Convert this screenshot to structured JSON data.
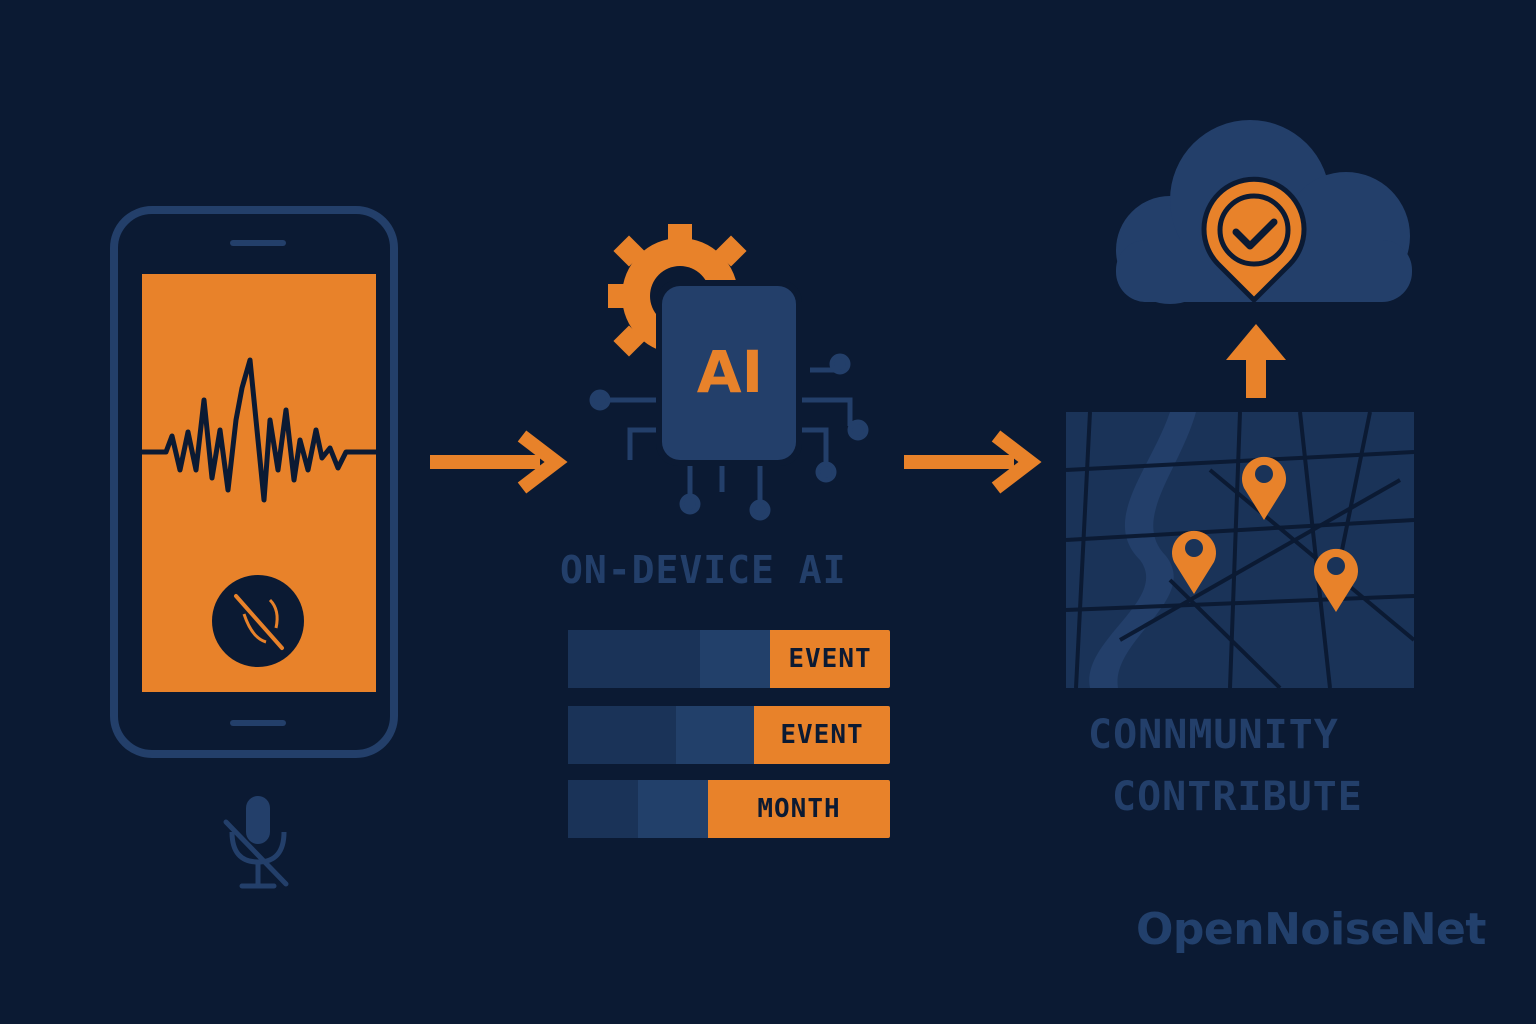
{
  "colors": {
    "background": "#0b1a33",
    "accent_orange": "#e8822a",
    "navy": "#233f6a",
    "dark_navy": "#1a3358"
  },
  "ai": {
    "chip_label": "AI",
    "caption": "ON-DEVICE AI"
  },
  "event_bars": [
    {
      "tag": "EVENT"
    },
    {
      "tag": "EVENT"
    },
    {
      "tag": "MONTH"
    }
  ],
  "community": {
    "line1": "CONNMUNITY",
    "line2": "CONTRIBUTE"
  },
  "brand": "OpenNoiseNet",
  "icons": [
    "smartphone-icon",
    "waveform-icon",
    "mute-badge-icon",
    "muted-microphone-icon",
    "arrow-right-icon",
    "gear-icon",
    "ai-chip-icon",
    "cloud-icon",
    "check-pin-icon",
    "arrow-up-icon",
    "map-icon",
    "map-pin-icon"
  ]
}
